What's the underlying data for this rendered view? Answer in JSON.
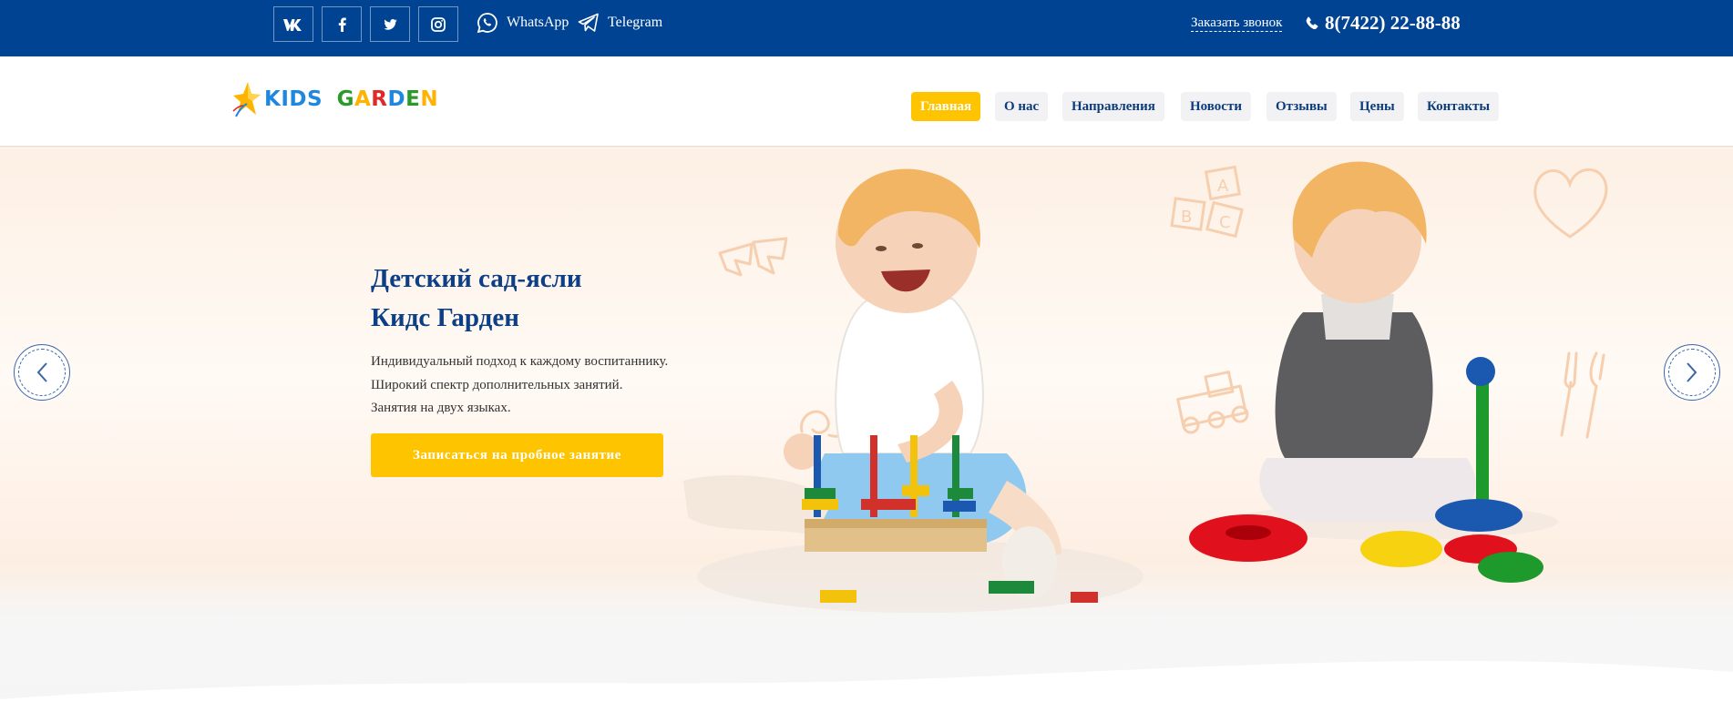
{
  "topbar": {
    "social": [
      {
        "name": "vk-icon",
        "label": "VK"
      },
      {
        "name": "facebook-icon",
        "label": "f"
      },
      {
        "name": "twitter-icon",
        "label": "twitter"
      },
      {
        "name": "instagram-icon",
        "label": "instagram"
      }
    ],
    "whatsapp_label": "WhatsApp",
    "telegram_label": "Telegram",
    "callback_label": "Заказать звонок",
    "phone": "8(7422) 22-88-88"
  },
  "logo": {
    "letters": [
      "K",
      "I",
      "D",
      "S",
      " ",
      "G",
      "A",
      "R",
      "D",
      "E",
      "N"
    ],
    "colors": [
      "#1e87e0",
      "#1e87e0",
      "#1e87e0",
      "#1e87e0",
      "#fff",
      "#2b9a2b",
      "#ffb300",
      "#e02a2a",
      "#1e87e0",
      "#2b9a2b",
      "#ffb300"
    ]
  },
  "nav": {
    "items": [
      {
        "label": "Главная",
        "active": true
      },
      {
        "label": "О нас",
        "active": false
      },
      {
        "label": "Направления",
        "active": false
      },
      {
        "label": "Новости",
        "active": false
      },
      {
        "label": "Отзывы",
        "active": false
      },
      {
        "label": "Цены",
        "active": false
      },
      {
        "label": "Контакты",
        "active": false
      }
    ]
  },
  "hero": {
    "title_line1": "Детский сад-ясли",
    "title_line2": "Кидс Гарден",
    "text_line1": "Индивидуальный подход к каждому воспитаннику.",
    "text_line2": "Широкий спектр дополнительных занятий.",
    "text_line3": "Занятия на двух языках.",
    "cta_label": "Записаться на пробное занятие"
  },
  "colors": {
    "topbar": "#004393",
    "accent": "#ffc400",
    "nav_text": "#0c3c7c",
    "title": "#0c3f86"
  }
}
